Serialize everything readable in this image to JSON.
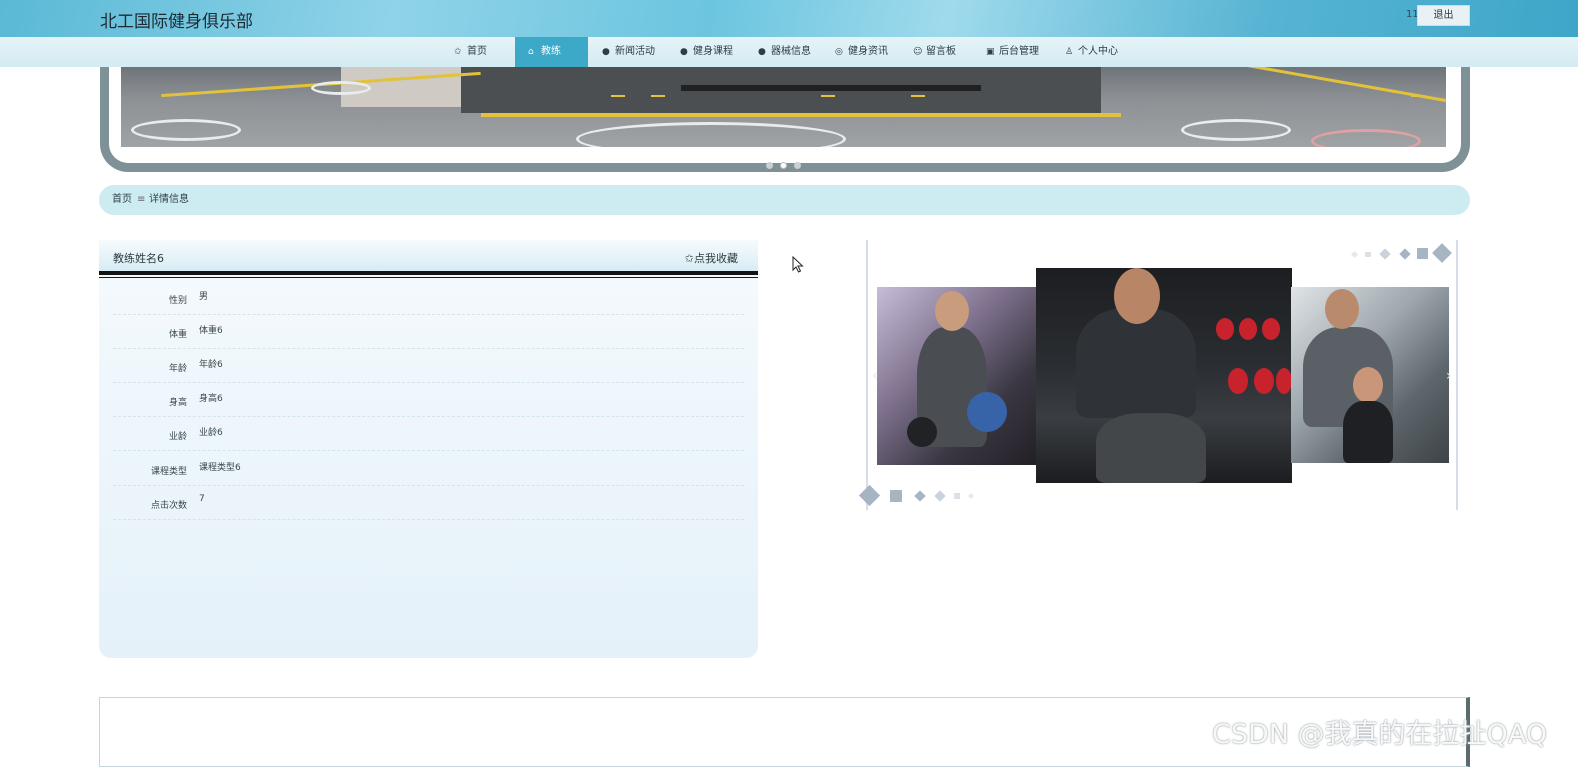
{
  "header": {
    "site_title": "北工国际健身俱乐部",
    "user_count": "11",
    "logout_label": "退出"
  },
  "nav": {
    "items": [
      {
        "icon": "star-icon",
        "label": "首页"
      },
      {
        "icon": "bag-icon",
        "label": "教练",
        "active": true
      },
      {
        "icon": "info-icon",
        "label": "新闻活动"
      },
      {
        "icon": "question-icon",
        "label": "健身课程"
      },
      {
        "icon": "info-icon",
        "label": "器械信息"
      },
      {
        "icon": "compass-icon",
        "label": "健身资讯"
      },
      {
        "icon": "smile-icon",
        "label": "留言板"
      },
      {
        "icon": "gift-icon",
        "label": "后台管理"
      },
      {
        "icon": "user-icon",
        "label": "个人中心"
      }
    ]
  },
  "carousel": {
    "active_index": 1,
    "count": 3
  },
  "breadcrumb": {
    "home": "首页",
    "separator": "≡",
    "current": "详情信息"
  },
  "detail": {
    "coach_name": "教练姓名6",
    "favorite_label": "✩点我收藏",
    "fields": [
      {
        "label": "性别",
        "value": "男"
      },
      {
        "label": "体重",
        "value": "体重6"
      },
      {
        "label": "年龄",
        "value": "年龄6"
      },
      {
        "label": "身高",
        "value": "身高6"
      },
      {
        "label": "业龄",
        "value": "业龄6"
      },
      {
        "label": "课程类型",
        "value": "课程类型6"
      },
      {
        "label": "点击次数",
        "value": "7"
      }
    ]
  },
  "gallery": {
    "prev_icon": "chevron-left-icon",
    "next_icon": "chevron-right-icon",
    "accent_color": "#a6b4c4"
  },
  "watermark": "CSDN @我真的在拉扯QAQ"
}
